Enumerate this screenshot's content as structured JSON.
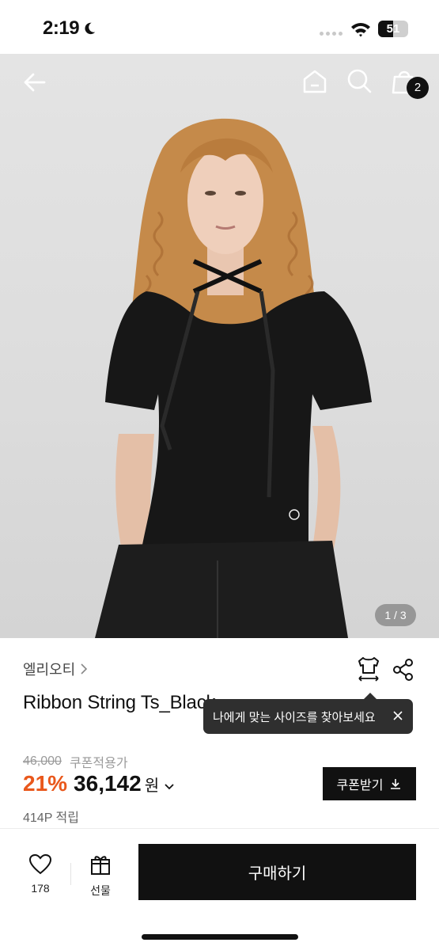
{
  "status_bar": {
    "time": "2:19",
    "battery": "51",
    "battery_level": 0.51
  },
  "header": {
    "cart_count": "2",
    "icons": [
      "back-arrow-icon",
      "home-icon",
      "search-icon",
      "shopping-bag-icon"
    ]
  },
  "gallery": {
    "indicator": "1 / 3",
    "current": 1,
    "total": 3
  },
  "product": {
    "brand": "엘리오티",
    "title": "Ribbon String Ts_Black",
    "size_tooltip": "나에게 맞는 사이즈를 찾아보세요",
    "original_price": "46,000",
    "coupon_label": "쿠폰적용가",
    "discount": "21%",
    "sale_price": "36,142",
    "currency": "원",
    "coupon_button": "쿠폰받기",
    "points": "414P 적립"
  },
  "bottom_bar": {
    "like_count": "178",
    "gift_label": "선물",
    "buy_label": "구매하기"
  },
  "colors": {
    "accent_discount": "#e9581c",
    "primary": "#111111",
    "tooltip_bg": "#2f2f2f"
  }
}
